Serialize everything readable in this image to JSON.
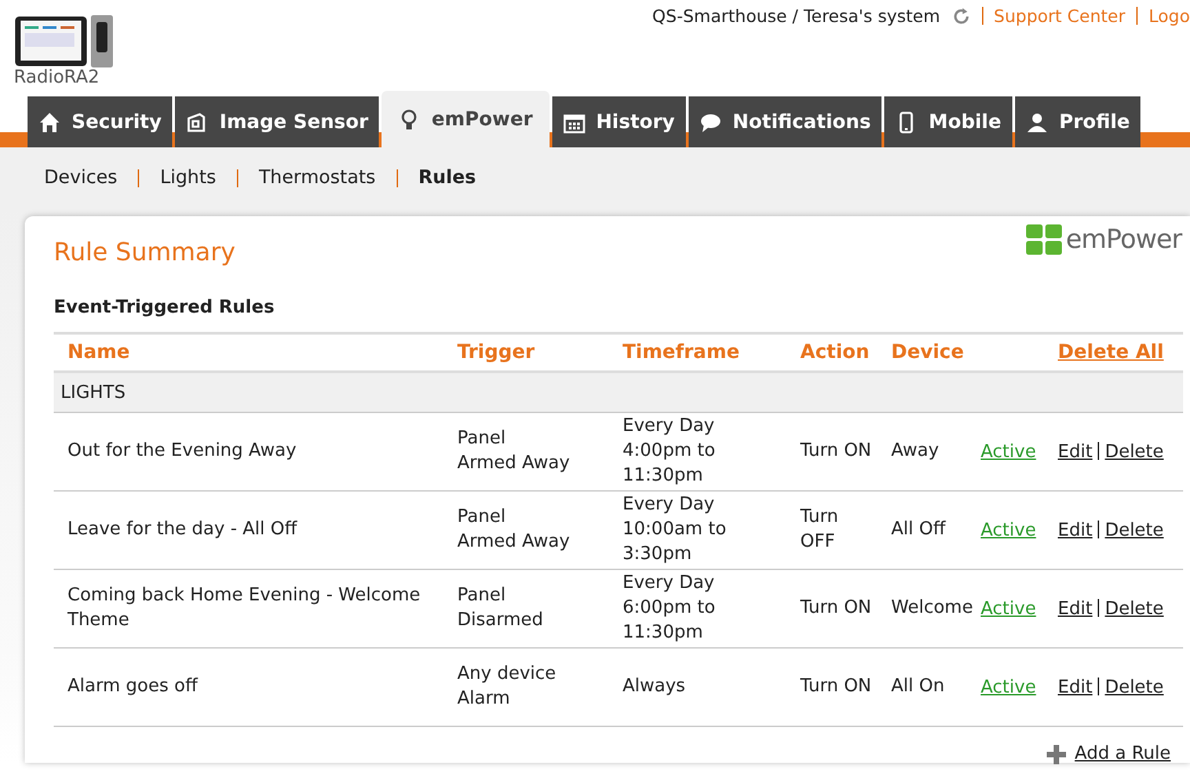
{
  "header": {
    "logo_text": "RadioRA2",
    "system": "QS-Smarthouse / Teresa's system",
    "links": [
      "Support Center",
      "Logo"
    ]
  },
  "tabs": [
    {
      "label": "Security",
      "kind": "home",
      "selected": false
    },
    {
      "label": "Image Sensor",
      "kind": "camera",
      "selected": false
    },
    {
      "label": "emPower",
      "kind": "bulb",
      "selected": true
    },
    {
      "label": "History",
      "kind": "calendar",
      "selected": false
    },
    {
      "label": "Notifications",
      "kind": "chat",
      "selected": false
    },
    {
      "label": "Mobile",
      "kind": "phone",
      "selected": false
    },
    {
      "label": "Profile",
      "kind": "person",
      "selected": false
    }
  ],
  "subnav": [
    {
      "label": "Devices",
      "selected": false
    },
    {
      "label": "Lights",
      "selected": false
    },
    {
      "label": "Thermostats",
      "selected": false
    },
    {
      "label": "Rules",
      "selected": true
    }
  ],
  "panel": {
    "title": "Rule Summary",
    "brand": "emPower",
    "section": "Event-Triggered Rules",
    "columns": [
      "Name",
      "Trigger",
      "Timeframe",
      "Action",
      "Device"
    ],
    "delete_all": "Delete All",
    "group": "LIGHTS",
    "rows": [
      {
        "name": "Out for the Evening Away",
        "trigger": [
          "Panel",
          "Armed Away"
        ],
        "timeframe": [
          "Every Day",
          "4:00pm to",
          "11:30pm"
        ],
        "action": [
          "Turn ON"
        ],
        "device": "Away",
        "status": "Active",
        "edit": "Edit",
        "delete": "Delete"
      },
      {
        "name": "Leave for the day - All Off",
        "trigger": [
          "Panel",
          "Armed Away"
        ],
        "timeframe": [
          "Every Day",
          "10:00am to",
          "3:30pm"
        ],
        "action": [
          "Turn",
          "OFF"
        ],
        "device": "All Off",
        "status": "Active",
        "edit": "Edit",
        "delete": "Delete"
      },
      {
        "name": "Coming back Home Evening - Welcome Theme",
        "trigger": [
          "Panel",
          "Disarmed"
        ],
        "timeframe": [
          "Every Day",
          "6:00pm to",
          "11:30pm"
        ],
        "action": [
          "Turn ON"
        ],
        "device": "Welcome",
        "status": "Active",
        "edit": "Edit",
        "delete": "Delete"
      },
      {
        "name": "Alarm goes off",
        "trigger": [
          "Any device",
          "Alarm"
        ],
        "timeframe": [
          "Always"
        ],
        "action": [
          "Turn ON"
        ],
        "device": "All On",
        "status": "Active",
        "edit": "Edit",
        "delete": "Delete"
      }
    ],
    "add_rule": "Add a Rule"
  }
}
